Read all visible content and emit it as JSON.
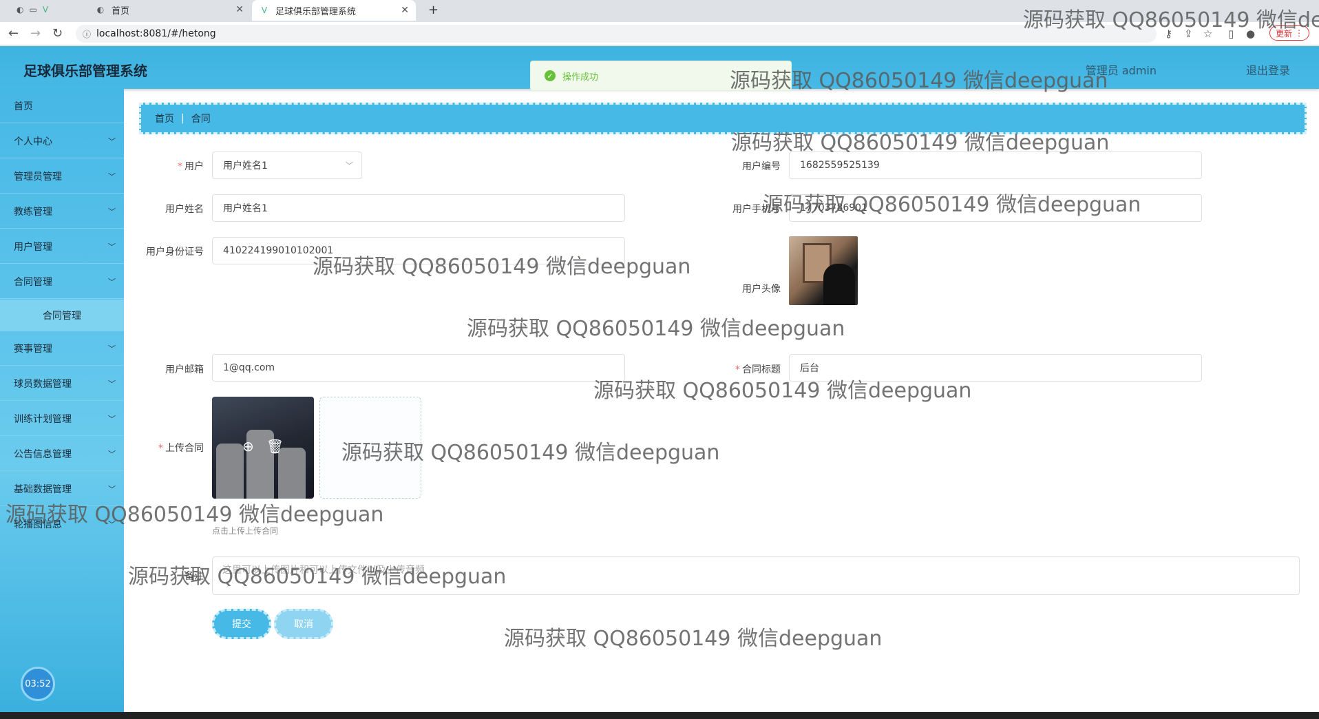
{
  "browser": {
    "tabs": [
      {
        "label": "首页"
      },
      {
        "label": "足球俱乐部管理系统"
      }
    ],
    "url": "localhost:8081/#/hetong",
    "update_label": "更新"
  },
  "header": {
    "title": "足球俱乐部管理系统",
    "admin": "管理员 admin",
    "logout": "退出登录"
  },
  "toast": {
    "message": "操作成功"
  },
  "sidebar": {
    "items": [
      {
        "label": "首页"
      },
      {
        "label": "个人中心"
      },
      {
        "label": "管理员管理"
      },
      {
        "label": "教练管理"
      },
      {
        "label": "用户管理"
      },
      {
        "label": "合同管理"
      },
      {
        "label": "合同管理"
      },
      {
        "label": "赛事管理"
      },
      {
        "label": "球员数据管理"
      },
      {
        "label": "训练计划管理"
      },
      {
        "label": "公告信息管理"
      },
      {
        "label": "基础数据管理"
      },
      {
        "label": "轮播图信息"
      }
    ],
    "clock": "03:52"
  },
  "breadcrumb": {
    "home": "首页",
    "current": "合同"
  },
  "form": {
    "user_label": "用户",
    "user_value": "用户姓名1",
    "user_no_label": "用户编号",
    "user_no_value": "1682559525139",
    "user_name_label": "用户姓名",
    "user_name_value": "用户姓名1",
    "user_phone_label": "用户手机号",
    "user_phone_value": "17703786901",
    "user_id_label": "用户身份证号",
    "user_id_value": "410224199010102001",
    "user_avatar_label": "用户头像",
    "user_email_label": "用户邮箱",
    "user_email_value": "1@qq.com",
    "contract_title_label": "合同标题",
    "contract_title_value": "后台",
    "upload_label": "上传合同",
    "upload_tip": "点击上传上传合同",
    "remark_label": "备注",
    "remark_placeholder": "这里可以上传图片和可以上传文件以及上传音频",
    "submit_label": "提交",
    "cancel_label": "取消"
  },
  "watermark": "源码获取 QQ86050149 微信deepguan"
}
